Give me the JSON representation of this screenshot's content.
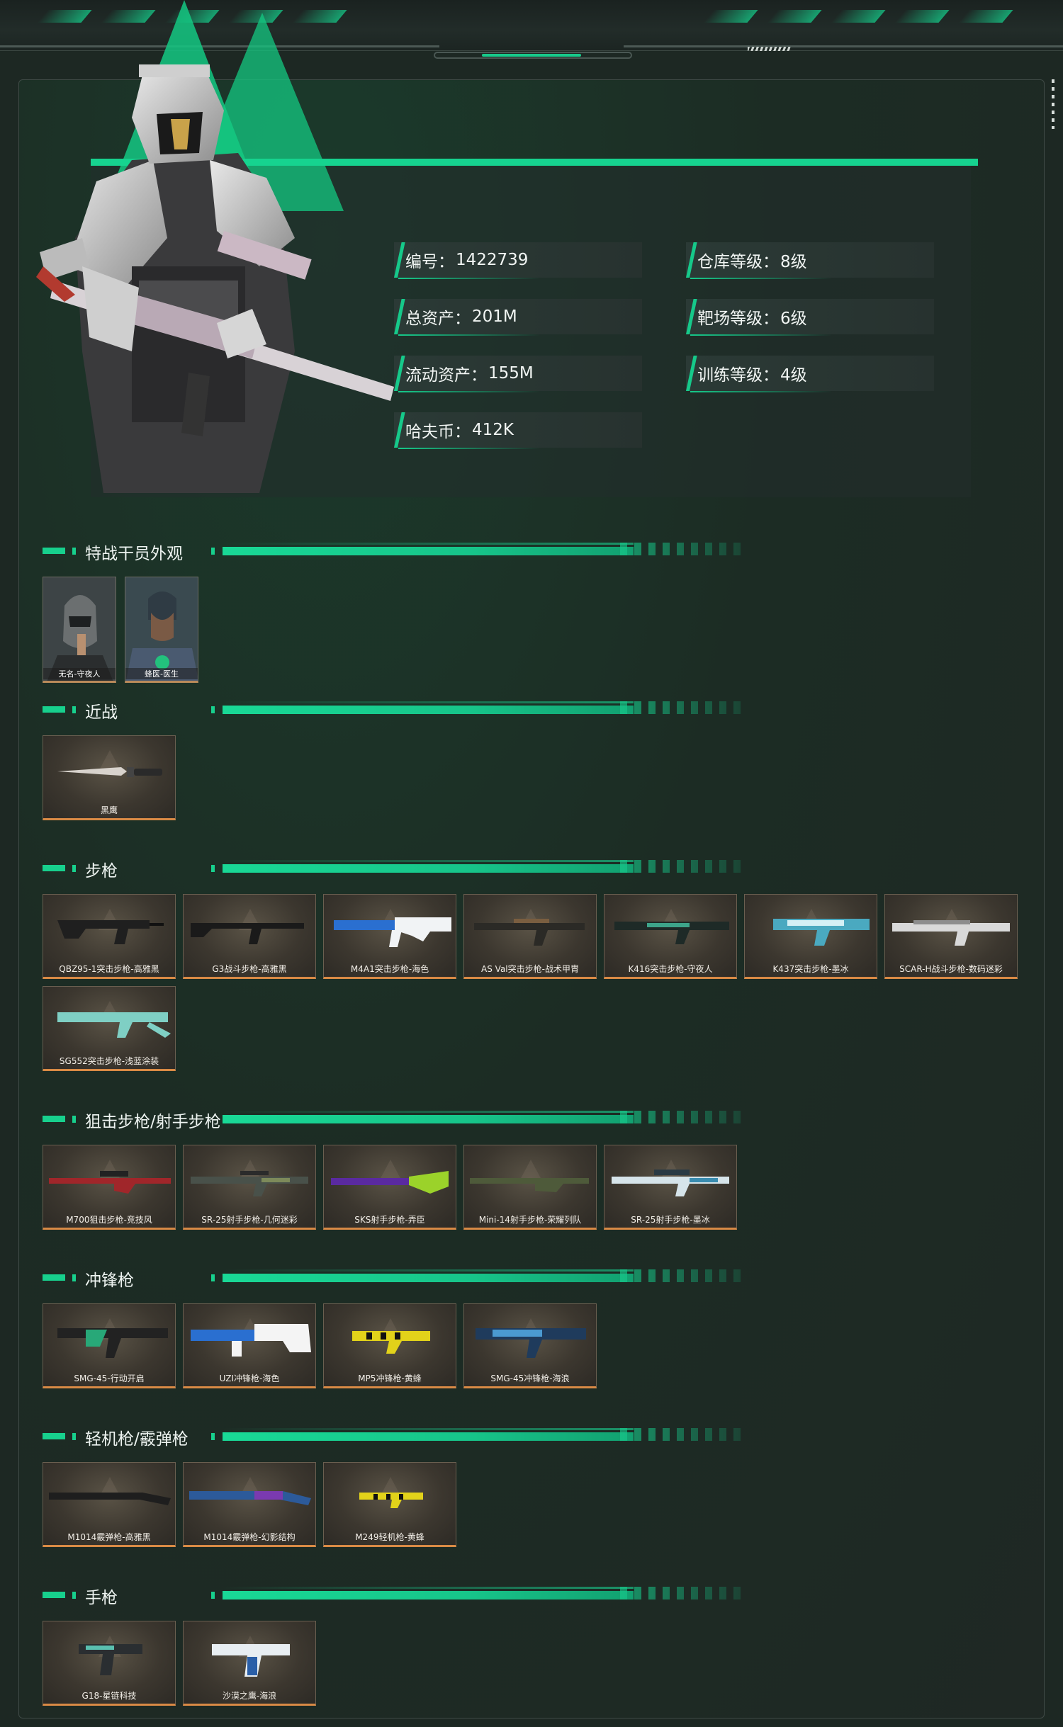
{
  "profile": {
    "stats_left": [
      {
        "label": "编号：",
        "value": "1422739"
      },
      {
        "label": "总资产：",
        "value": "201M"
      },
      {
        "label": "流动资产：",
        "value": "155M"
      },
      {
        "label": "哈夫币：",
        "value": "412K"
      }
    ],
    "stats_right": [
      {
        "label": "仓库等级：",
        "value": "8级"
      },
      {
        "label": "靶场等级：",
        "value": "6级"
      },
      {
        "label": "训练等级：",
        "value": "4级"
      }
    ]
  },
  "sections": {
    "operators": {
      "title": "特战干员外观",
      "items": [
        "无名-守夜人",
        "蜂医-医生"
      ]
    },
    "melee": {
      "title": "近战",
      "items": [
        "黑鹰"
      ]
    },
    "rifles": {
      "title": "步枪",
      "items": [
        "QBZ95-1突击步枪-高雅黑",
        "G3战斗步枪-高雅黑",
        "M4A1突击步枪-海色",
        "AS Val突击步枪-战术甲胄",
        "K416突击步枪-守夜人",
        "K437突击步枪-墨冰",
        "SCAR-H战斗步枪-数码迷彩",
        "SG552突击步枪-浅蓝涂装"
      ]
    },
    "snipers": {
      "title": "狙击步枪/射手步枪",
      "items": [
        "M700狙击步枪-竞技风",
        "SR-25射手步枪-几何迷彩",
        "SKS射手步枪-弄臣",
        "Mini-14射手步枪-荣耀列队",
        "SR-25射手步枪-墨冰"
      ]
    },
    "smgs": {
      "title": "冲锋枪",
      "items": [
        "SMG-45-行动开启",
        "UZI冲锋枪-海色",
        "MP5冲锋枪-黄蜂",
        "SMG-45冲锋枪-海浪"
      ]
    },
    "lmgs": {
      "title": "轻机枪/霰弹枪",
      "items": [
        "M1014霰弹枪-高雅黑",
        "M1014霰弹枪-幻影结构",
        "M249轻机枪-黄蜂"
      ]
    },
    "pistols": {
      "title": "手枪",
      "items": [
        "G18-星链科技",
        "沙漠之鹰-海浪"
      ]
    }
  },
  "colors": {
    "accent": "#17d08d",
    "card_border": "#d98a45",
    "background": "#1d2823"
  }
}
